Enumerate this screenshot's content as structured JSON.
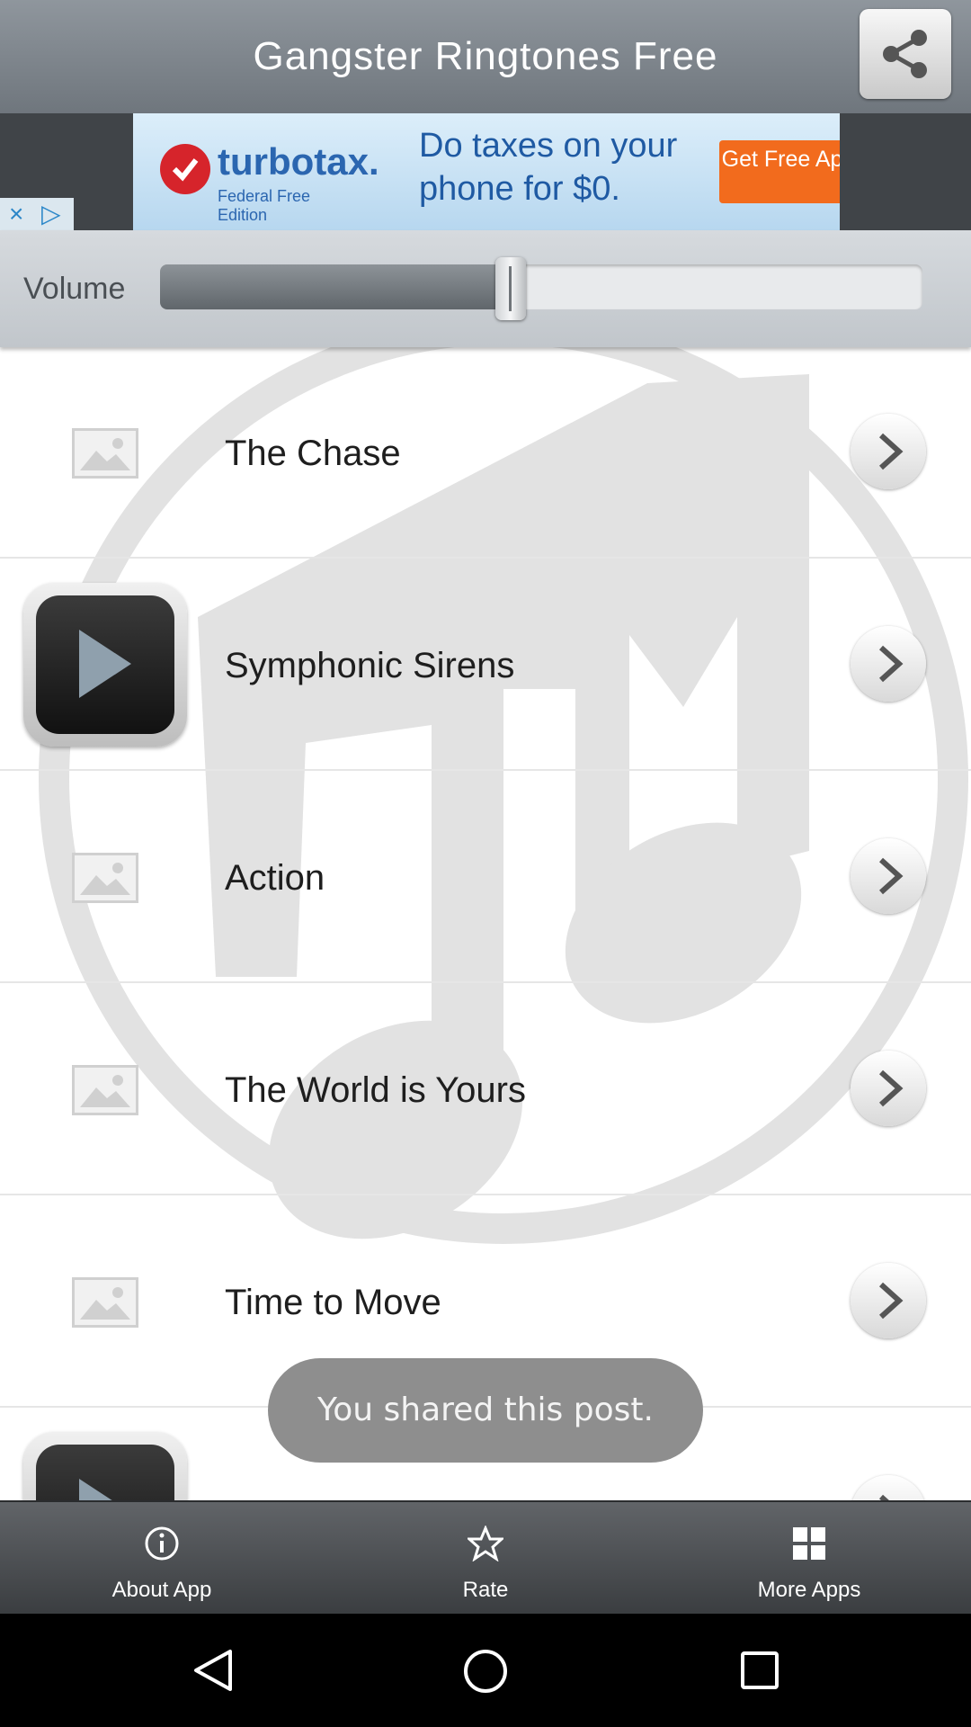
{
  "header": {
    "title": "Gangster Ringtones Free",
    "share_icon": "share-icon"
  },
  "ad": {
    "brand": "turbotax.",
    "brand_sub": "Federal Free Edition",
    "text": "Do taxes on your phone for $0.",
    "cta": "Get Free App",
    "close_glyph": "×",
    "adchoices_glyph": "▷"
  },
  "volume": {
    "label": "Volume",
    "level_percent": 46
  },
  "list": {
    "items": [
      {
        "title": "The Chase",
        "thumb": "image-placeholder-icon"
      },
      {
        "title": "Symphonic Sirens",
        "thumb": "play-icon"
      },
      {
        "title": "Action",
        "thumb": "image-placeholder-icon"
      },
      {
        "title": "The World is Yours",
        "thumb": "image-placeholder-icon"
      },
      {
        "title": "Time to Move",
        "thumb": "image-placeholder-icon"
      },
      {
        "title": "",
        "thumb": "play-icon"
      }
    ]
  },
  "toast": {
    "text": "You shared this post."
  },
  "bottom_bar": {
    "items": [
      {
        "label": "About App",
        "icon": "info-icon"
      },
      {
        "label": "Rate",
        "icon": "star-icon"
      },
      {
        "label": "More Apps",
        "icon": "grid-icon"
      }
    ]
  },
  "nav": {
    "back": "back-icon",
    "home": "home-icon",
    "recents": "recents-icon"
  },
  "colors": {
    "header": "#7f868d",
    "bottom_bar": "#4a4d50",
    "ad_cta": "#f26b1d",
    "brand_blue": "#2b66b0"
  }
}
